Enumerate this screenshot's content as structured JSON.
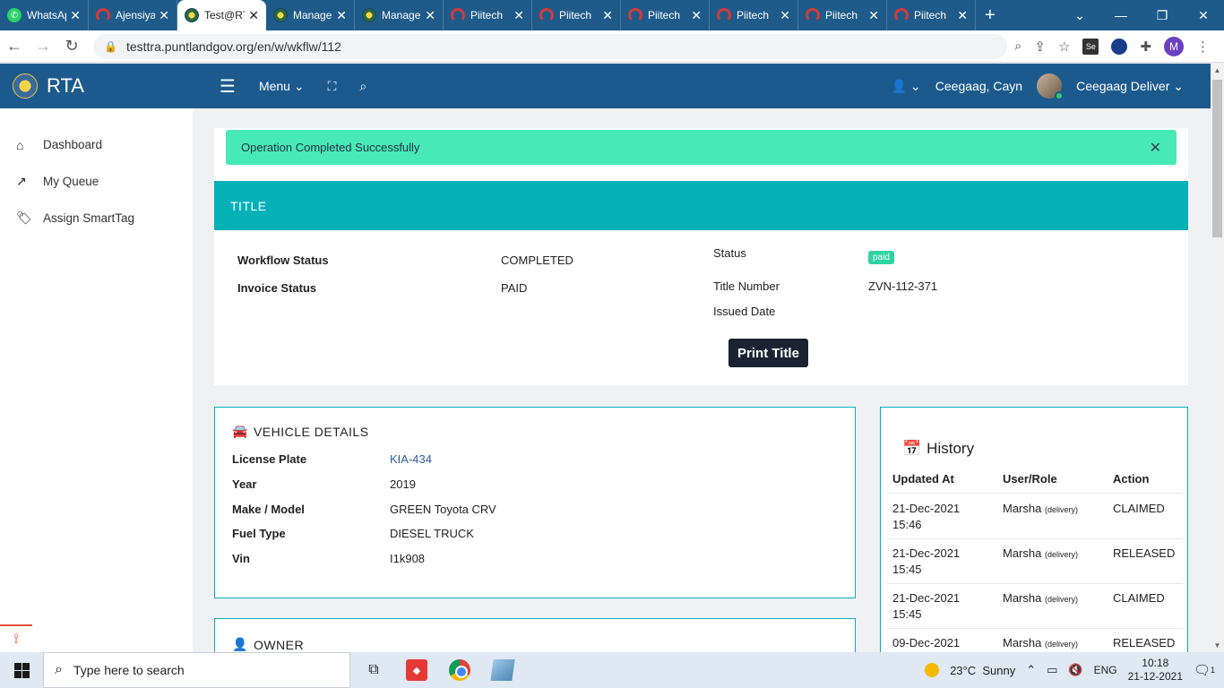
{
  "browser": {
    "tabs": [
      {
        "label": "WhatsApp",
        "fav": "wa"
      },
      {
        "label": "Ajensiyada",
        "fav": "pi"
      },
      {
        "label": "Test@RTA",
        "fav": "cr",
        "active": true
      },
      {
        "label": "Manage",
        "fav": "cr"
      },
      {
        "label": "Manage",
        "fav": "cr"
      },
      {
        "label": "Piitech",
        "fav": "pi"
      },
      {
        "label": "Piitech",
        "fav": "pi"
      },
      {
        "label": "Piitech",
        "fav": "pi"
      },
      {
        "label": "Piitech",
        "fav": "pi"
      },
      {
        "label": "Piitech",
        "fav": "pi"
      },
      {
        "label": "Piitech",
        "fav": "pi"
      }
    ],
    "url": "testtra.puntlandgov.org/en/w/wkflw/112",
    "profile_initial": "M",
    "ext_se_label": "Se"
  },
  "app": {
    "brand": "RTA",
    "menu_label": "Menu",
    "user_name": "Ceegaag, Cayn",
    "role_label": "Ceegaag Deliver"
  },
  "sidebar": {
    "items": [
      {
        "label": "Dashboard",
        "icon": "home-icon"
      },
      {
        "label": "My Queue",
        "icon": "trend-icon"
      },
      {
        "label": "Assign SmartTag",
        "icon": "tags-icon"
      }
    ]
  },
  "alert": {
    "message": "Operation Completed Successfully"
  },
  "title_section": {
    "heading": "TITLE",
    "workflow_status_label": "Workflow Status",
    "workflow_status_value": "COMPLETED",
    "invoice_status_label": "Invoice Status",
    "invoice_status_value": "PAID",
    "status_label": "Status",
    "status_badge": "paid",
    "title_number_label": "Title Number",
    "title_number_value": "ZVN-112-371",
    "issued_date_label": "Issued Date",
    "print_button": "Print Title"
  },
  "vehicle": {
    "heading": "VEHICLE DETAILS",
    "rows": [
      {
        "label": "License Plate",
        "value": "KIA-434"
      },
      {
        "label": "Year",
        "value": "2019"
      },
      {
        "label": "Make / Model",
        "value": "GREEN Toyota CRV"
      },
      {
        "label": "Fuel Type",
        "value": "DIESEL TRUCK"
      },
      {
        "label": "Vin",
        "value": "I1k908"
      }
    ]
  },
  "owner": {
    "heading": "OWNER"
  },
  "history": {
    "heading": "History",
    "columns": [
      "Updated At",
      "User/Role",
      "Action"
    ],
    "rows": [
      {
        "date": "21-Dec-2021",
        "time": "15:46",
        "user": "Marsha",
        "role": "(delivery)",
        "action": "CLAIMED"
      },
      {
        "date": "21-Dec-2021",
        "time": "15:45",
        "user": "Marsha",
        "role": "(delivery)",
        "action": "RELEASED"
      },
      {
        "date": "21-Dec-2021",
        "time": "15:45",
        "user": "Marsha",
        "role": "(delivery)",
        "action": "CLAIMED"
      },
      {
        "date": "09-Dec-2021",
        "time": "",
        "user": "Marsha",
        "role": "(delivery)",
        "action": "RELEASED"
      }
    ]
  },
  "taskbar": {
    "search_placeholder": "Type here to search",
    "weather": "23°C  Sunny",
    "lang": "ENG",
    "time": "10:18",
    "date": "21-12-2021",
    "notif_count": "1"
  }
}
